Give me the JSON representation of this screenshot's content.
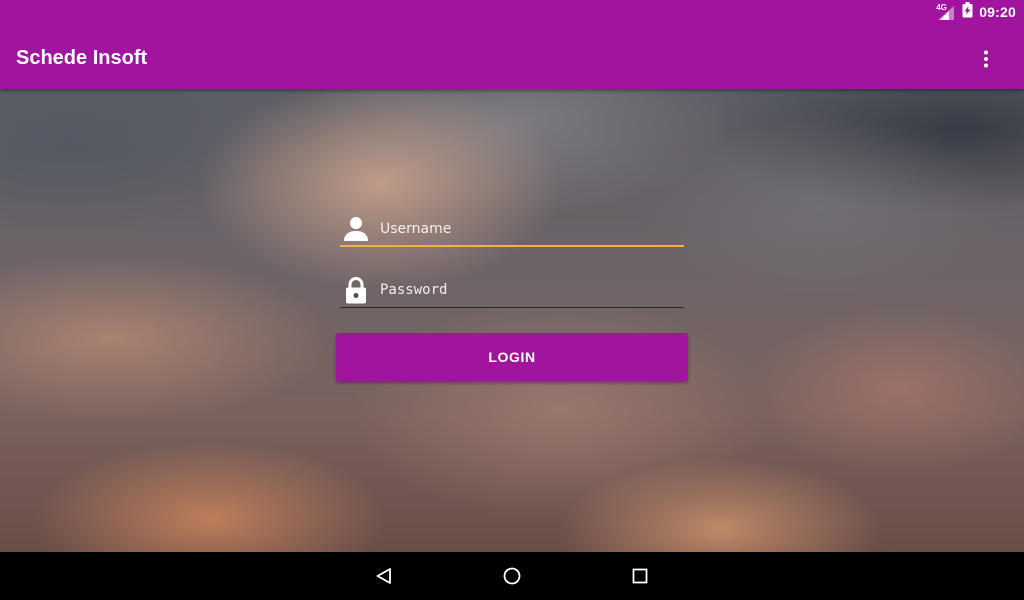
{
  "status_bar": {
    "network_type": "4G",
    "time": "09:20",
    "icons": [
      "signal-icon",
      "battery-charging-icon"
    ]
  },
  "app_bar": {
    "title": "Schede Insoft",
    "overflow_icon": "more-vert-icon"
  },
  "login": {
    "username": {
      "placeholder": "Username",
      "value": "",
      "icon": "person-icon"
    },
    "password": {
      "placeholder": "Password",
      "value": "",
      "icon": "lock-icon"
    },
    "button_label": "LOGIN"
  },
  "nav_bar": {
    "icons": [
      "back-icon",
      "home-icon",
      "recents-icon"
    ]
  },
  "colors": {
    "primary": "#a0149e",
    "accent_underline": "#f0b23c",
    "text_on_primary": "#ffffff"
  }
}
